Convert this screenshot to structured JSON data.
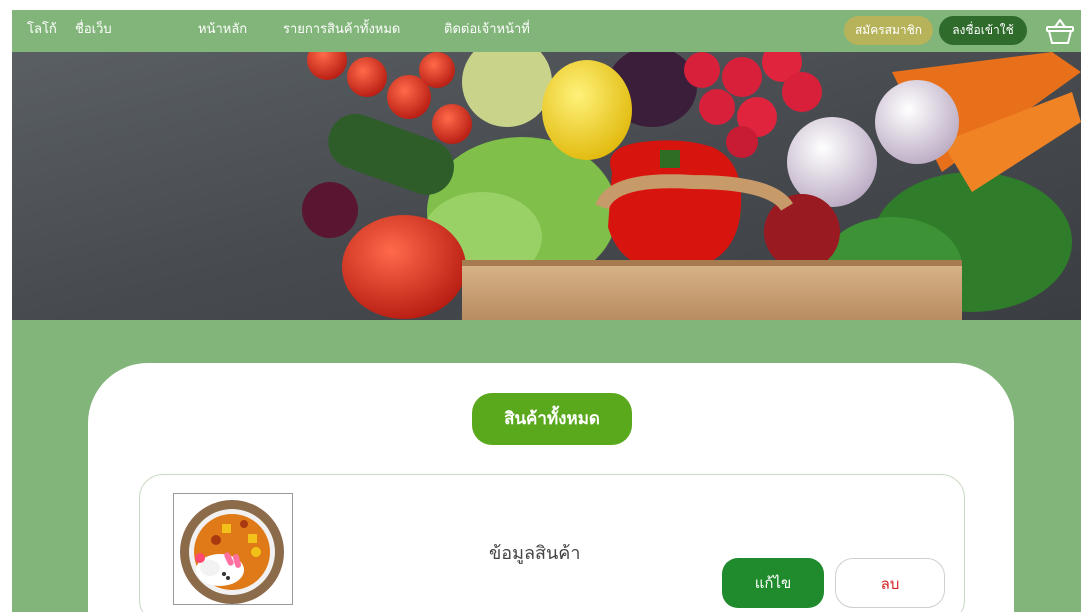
{
  "nav": {
    "logo": "โลโก้",
    "site_name": "ชื่อเว็บ",
    "links": [
      "หน้าหลัก",
      "รายการสินค้าทั้งหมด",
      "ติดต่อเจ้าหน้าที่"
    ],
    "register_label": "สมัครสมาชิก",
    "login_label": "ลงชื่อเข้าใช้",
    "basket_icon": "basket-icon"
  },
  "main": {
    "section_title": "สินค้าทั้งหมด",
    "product": {
      "info_label": "ข้อมูลสินค้า",
      "edit_label": "แก้ไข",
      "delete_label": "ลบ"
    }
  },
  "colors": {
    "nav_bg": "#82b57a",
    "title_pill": "#5aa81c",
    "edit_button": "#1f8b2c",
    "delete_text": "#d62424",
    "register_pill": "#b7b35a",
    "login_pill": "#2f6b2a"
  }
}
